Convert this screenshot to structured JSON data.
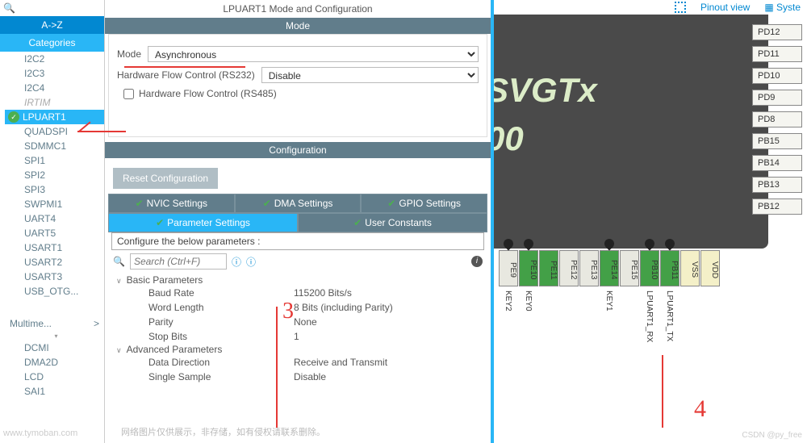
{
  "header": {
    "title": "LPUART1 Mode and Configuration",
    "mode_title": "Mode",
    "config_title": "Configuration"
  },
  "left": {
    "az": "A->Z",
    "categories": "Categories",
    "items": [
      "I2C2",
      "I2C3",
      "I2C4",
      "IRTIM",
      "LPUART1",
      "QUADSPI",
      "SDMMC1",
      "SPI1",
      "SPI2",
      "SPI3",
      "SWPMI1",
      "UART4",
      "UART5",
      "USART1",
      "USART2",
      "USART3",
      "USB_OTG..."
    ],
    "multime": "Multime...",
    "sub": [
      "DCMI",
      "DMA2D",
      "LCD",
      "SAI1"
    ]
  },
  "mode": {
    "mode_label": "Mode",
    "mode_value": "Asynchronous",
    "hw_flow_label": "Hardware Flow Control (RS232)",
    "hw_flow_value": "Disable",
    "hw485_label": "Hardware Flow Control (RS485)"
  },
  "config": {
    "reset": "Reset Configuration",
    "tabs1": [
      "NVIC Settings",
      "DMA Settings",
      "GPIO Settings"
    ],
    "tabs2": [
      "Parameter Settings",
      "User Constants"
    ],
    "hint": "Configure the below parameters :",
    "search_ph": "Search (Ctrl+F)",
    "basic": "Basic Parameters",
    "params": [
      {
        "n": "Baud Rate",
        "v": "115200 Bits/s"
      },
      {
        "n": "Word Length",
        "v": "8 Bits (including Parity)"
      },
      {
        "n": "Parity",
        "v": "None"
      },
      {
        "n": "Stop Bits",
        "v": "1"
      }
    ],
    "advanced": "Advanced Parameters",
    "adv_params": [
      {
        "n": "Data Direction",
        "v": "Receive and Transmit"
      },
      {
        "n": "Single Sample",
        "v": "Disable"
      }
    ]
  },
  "right": {
    "pinout": "Pinout view",
    "system": "Syste",
    "chip1": "SVGTx",
    "chip2": "00",
    "pins_r": [
      "PD12",
      "PD11",
      "PD10",
      "PD9",
      "PD8",
      "PB15",
      "PB14",
      "PB13",
      "PB12"
    ],
    "pins_b": [
      "PE9",
      "PE10",
      "PE11",
      "PE12",
      "PE13",
      "PE14",
      "PE15",
      "PB10",
      "PB11",
      "VSS",
      "VDD"
    ],
    "pins_lbl": [
      "KEY2",
      "KEY0",
      "",
      "",
      "",
      "KEY1",
      "",
      "LPUART1_RX",
      "LPUART1_TX",
      "",
      ""
    ]
  },
  "wm1": "www.tymoban.com",
  "wm2": "网络图片仅供展示，非存储，如有侵权请联系删除。",
  "csdn": "CSDN @py_free"
}
